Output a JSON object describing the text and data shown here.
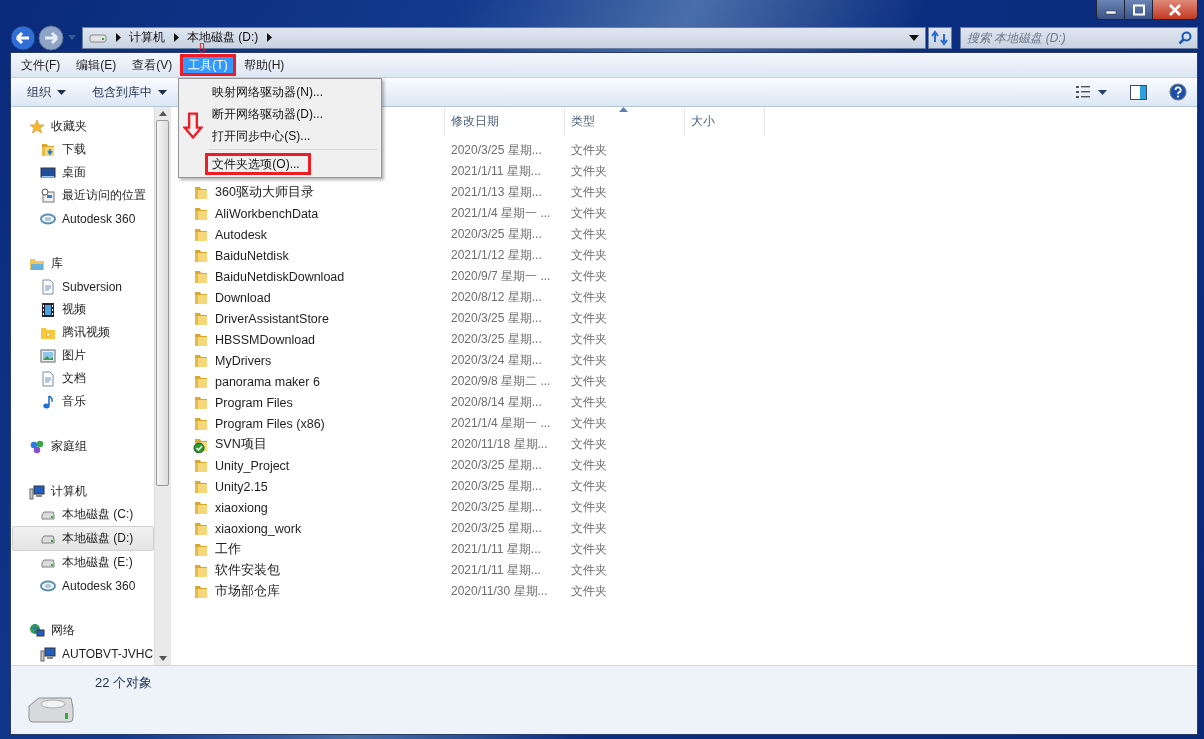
{
  "address": {
    "crumbs": [
      "计算机",
      "本地磁盘 (D:)"
    ]
  },
  "search": {
    "placeholder": "搜索 本地磁盘 (D:)"
  },
  "menu_bar": [
    {
      "label": "文件(F)",
      "selected": false,
      "highlighted": false
    },
    {
      "label": "编辑(E)",
      "selected": false,
      "highlighted": false
    },
    {
      "label": "查看(V)",
      "selected": false,
      "highlighted": false
    },
    {
      "label": "工具(T)",
      "selected": true,
      "highlighted": true
    },
    {
      "label": "帮助(H)",
      "selected": false,
      "highlighted": false
    }
  ],
  "menu": {
    "items": [
      {
        "label": "映射网络驱动器(N)...",
        "separator_before": false,
        "highlighted": false
      },
      {
        "label": "断开网络驱动器(D)...",
        "separator_before": false,
        "highlighted": false
      },
      {
        "label": "打开同步中心(S)...",
        "separator_before": false,
        "highlighted": false
      },
      {
        "label": "文件夹选项(O)...",
        "separator_before": true,
        "highlighted": true
      }
    ]
  },
  "toolbar": {
    "buttons": [
      "组织",
      "包含到库中"
    ]
  },
  "nav_pane": {
    "groups": [
      {
        "label": "收藏夹",
        "kind": "star",
        "children": [
          {
            "label": "下载",
            "kind": "download",
            "selected": false
          },
          {
            "label": "桌面",
            "kind": "desktop",
            "selected": false
          },
          {
            "label": "最近访问的位置",
            "kind": "recent",
            "selected": false
          },
          {
            "label": "Autodesk 360",
            "kind": "cloud",
            "selected": false
          }
        ]
      },
      {
        "label": "库",
        "kind": "library",
        "children": [
          {
            "label": "Subversion",
            "kind": "doc",
            "selected": false
          },
          {
            "label": "视频",
            "kind": "film",
            "selected": false
          },
          {
            "label": "腾讯视频",
            "kind": "folder",
            "selected": false
          },
          {
            "label": "图片",
            "kind": "image",
            "selected": false
          },
          {
            "label": "文档",
            "kind": "doc",
            "selected": false
          },
          {
            "label": "音乐",
            "kind": "music",
            "selected": false
          }
        ]
      },
      {
        "label": "家庭组",
        "kind": "homegroup"
      },
      {
        "label": "计算机",
        "kind": "computer",
        "children": [
          {
            "label": "本地磁盘 (C:)",
            "kind": "drive",
            "selected": false
          },
          {
            "label": "本地磁盘 (D:)",
            "kind": "drive",
            "selected": true
          },
          {
            "label": "本地磁盘 (E:)",
            "kind": "drive",
            "selected": false
          },
          {
            "label": "Autodesk 360",
            "kind": "cloud",
            "selected": false
          }
        ]
      },
      {
        "label": "网络",
        "kind": "network",
        "children": [
          {
            "label": "AUTOBVT-JVHC",
            "kind": "computer",
            "selected": false
          }
        ]
      }
    ]
  },
  "file_list": {
    "columns": [
      {
        "label": "修改日期",
        "sorted": false
      },
      {
        "label": "类型",
        "sorted": true
      },
      {
        "label": "大小",
        "sorted": false
      }
    ],
    "rows": [
      {
        "date": "2020/3/25 星期...",
        "type": "文件夹"
      },
      {
        "date": "2021/1/11 星期...",
        "type": "文件夹"
      },
      {
        "name": "360驱动大师目录",
        "kind": "folder",
        "date": "2021/1/13 星期...",
        "type": "文件夹"
      },
      {
        "name": "AliWorkbenchData",
        "kind": "folder",
        "date": "2021/1/4 星期一 ...",
        "type": "文件夹"
      },
      {
        "name": "Autodesk",
        "kind": "folder",
        "date": "2020/3/25 星期...",
        "type": "文件夹"
      },
      {
        "name": "BaiduNetdisk",
        "kind": "folder",
        "date": "2021/1/12 星期...",
        "type": "文件夹"
      },
      {
        "name": "BaiduNetdiskDownload",
        "kind": "folder",
        "date": "2020/9/7 星期一 ...",
        "type": "文件夹"
      },
      {
        "name": "Download",
        "kind": "folder",
        "date": "2020/8/12 星期...",
        "type": "文件夹"
      },
      {
        "name": "DriverAssistantStore",
        "kind": "folder",
        "date": "2020/3/25 星期...",
        "type": "文件夹"
      },
      {
        "name": "HBSSMDownload",
        "kind": "folder",
        "date": "2020/3/25 星期...",
        "type": "文件夹"
      },
      {
        "name": "MyDrivers",
        "kind": "folder",
        "date": "2020/3/24 星期...",
        "type": "文件夹"
      },
      {
        "name": "panorama maker 6",
        "kind": "folder",
        "date": "2020/9/8 星期二 ...",
        "type": "文件夹"
      },
      {
        "name": "Program Files",
        "kind": "folder",
        "date": "2020/8/14 星期...",
        "type": "文件夹"
      },
      {
        "name": "Program Files (x86)",
        "kind": "folder",
        "date": "2021/1/4 星期一 ...",
        "type": "文件夹"
      },
      {
        "name": "SVN项目",
        "kind": "svn",
        "date": "2020/11/18 星期...",
        "type": "文件夹"
      },
      {
        "name": "Unity_Project",
        "kind": "folder",
        "date": "2020/3/25 星期...",
        "type": "文件夹"
      },
      {
        "name": "Unity2.15",
        "kind": "folder",
        "date": "2020/3/25 星期...",
        "type": "文件夹"
      },
      {
        "name": "xiaoxiong",
        "kind": "folder",
        "date": "2020/3/25 星期...",
        "type": "文件夹"
      },
      {
        "name": "xiaoxiong_work",
        "kind": "folder",
        "date": "2020/3/25 星期...",
        "type": "文件夹"
      },
      {
        "name": "工作",
        "kind": "folder",
        "date": "2021/1/11 星期...",
        "type": "文件夹"
      },
      {
        "name": "软件安装包",
        "kind": "folder",
        "date": "2021/1/11 星期...",
        "type": "文件夹"
      },
      {
        "name": "市场部仓库",
        "kind": "folder",
        "date": "2020/11/30 星期...",
        "type": "文件夹"
      }
    ]
  },
  "status_bar": {
    "count": "22 个对象"
  }
}
